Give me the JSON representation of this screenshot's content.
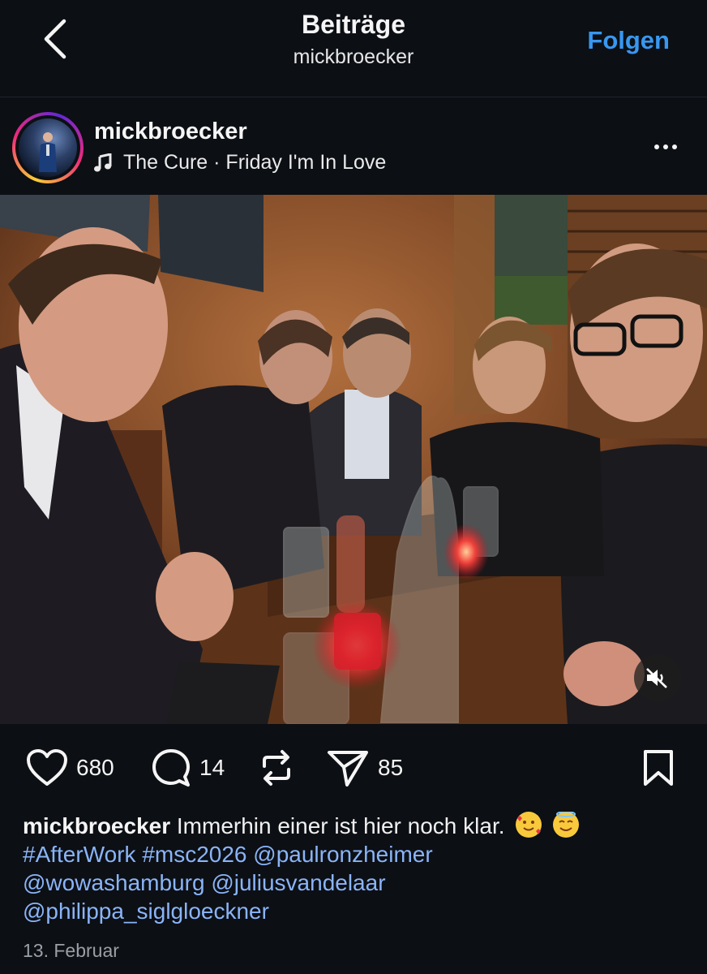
{
  "nav": {
    "title": "Beiträge",
    "subtitle": "mickbroecker",
    "follow_label": "Folgen",
    "back_icon": "chevron-left-icon"
  },
  "post": {
    "username": "mickbroecker",
    "music": "The Cure · Friday I'm In Love",
    "music_icon": "music-note-icon",
    "more_icon": "more-horizontal-icon",
    "photo_icon": "photo",
    "mute_icon": "speaker-muted-icon"
  },
  "actions": {
    "likes": "680",
    "comments": "14",
    "reposts": "",
    "shares": "85"
  },
  "caption": {
    "username": "mickbroecker",
    "text": "Immerhin einer ist hier noch klar.",
    "emojis": [
      "smiling-face-with-hearts",
      "smiling-face-with-halo"
    ],
    "hashtags": [
      "#AfterWork",
      "#msc2026"
    ],
    "mentions": [
      "@paulronzheimer",
      "@wowashamburg",
      "@juliusvandelaar",
      "@philippa_siglgloeckner"
    ]
  },
  "date": "13. Februar",
  "colors": {
    "background": "#0c0f14",
    "link": "#3897f0",
    "tag": "#8ab4f8",
    "muted": "#9aa0a6"
  }
}
